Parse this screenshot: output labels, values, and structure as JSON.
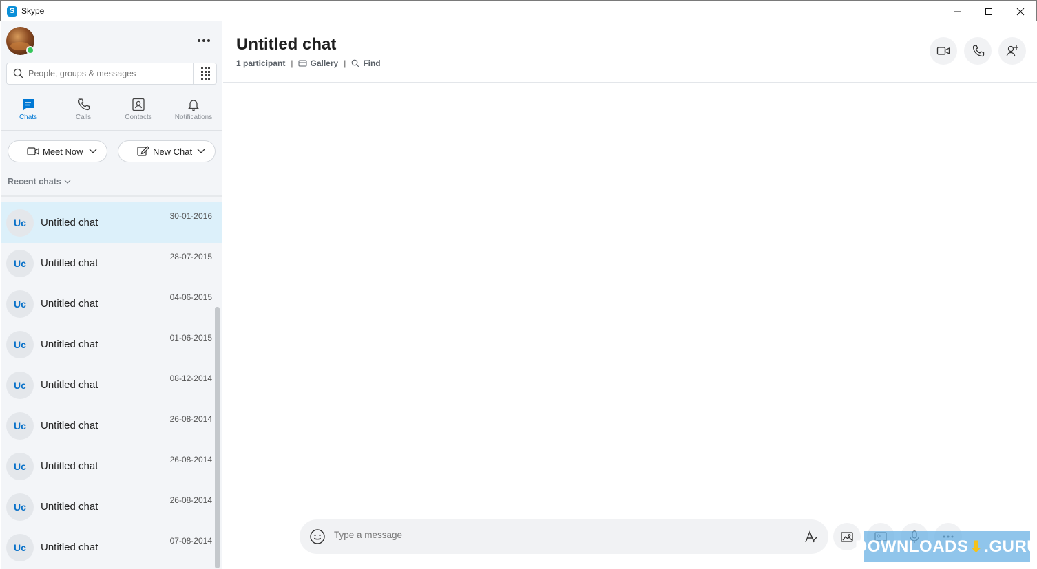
{
  "window": {
    "app_title": "Skype",
    "logo_letter": "S"
  },
  "sidebar": {
    "search": {
      "placeholder": "People, groups & messages"
    },
    "nav": [
      {
        "label": "Chats",
        "icon": "chat-icon",
        "active": true
      },
      {
        "label": "Calls",
        "icon": "phone-icon",
        "active": false
      },
      {
        "label": "Contacts",
        "icon": "contacts-icon",
        "active": false
      },
      {
        "label": "Notifications",
        "icon": "bell-icon",
        "active": false
      }
    ],
    "meet_now_label": "Meet Now",
    "new_chat_label": "New Chat",
    "recent_label": "Recent chats",
    "chats": [
      {
        "initials": "Uc",
        "name": "Untitled chat",
        "date": "30-01-2016",
        "selected": true
      },
      {
        "initials": "Uc",
        "name": "Untitled chat",
        "date": "28-07-2015",
        "selected": false
      },
      {
        "initials": "Uc",
        "name": "Untitled chat",
        "date": "04-06-2015",
        "selected": false
      },
      {
        "initials": "Uc",
        "name": "Untitled chat",
        "date": "01-06-2015",
        "selected": false
      },
      {
        "initials": "Uc",
        "name": "Untitled chat",
        "date": "08-12-2014",
        "selected": false
      },
      {
        "initials": "Uc",
        "name": "Untitled chat",
        "date": "26-08-2014",
        "selected": false
      },
      {
        "initials": "Uc",
        "name": "Untitled chat",
        "date": "26-08-2014",
        "selected": false
      },
      {
        "initials": "Uc",
        "name": "Untitled chat",
        "date": "26-08-2014",
        "selected": false
      },
      {
        "initials": "Uc",
        "name": "Untitled chat",
        "date": "07-08-2014",
        "selected": false
      }
    ]
  },
  "main": {
    "title": "Untitled chat",
    "participants": "1 participant",
    "gallery_label": "Gallery",
    "find_label": "Find",
    "composer": {
      "placeholder": "Type a message"
    }
  },
  "watermark": {
    "left": "DOWNLOADS",
    "right": ".GURU"
  },
  "colors": {
    "accent": "#0078d4",
    "selected_row": "#dcf0fa",
    "online": "#35c65a"
  }
}
